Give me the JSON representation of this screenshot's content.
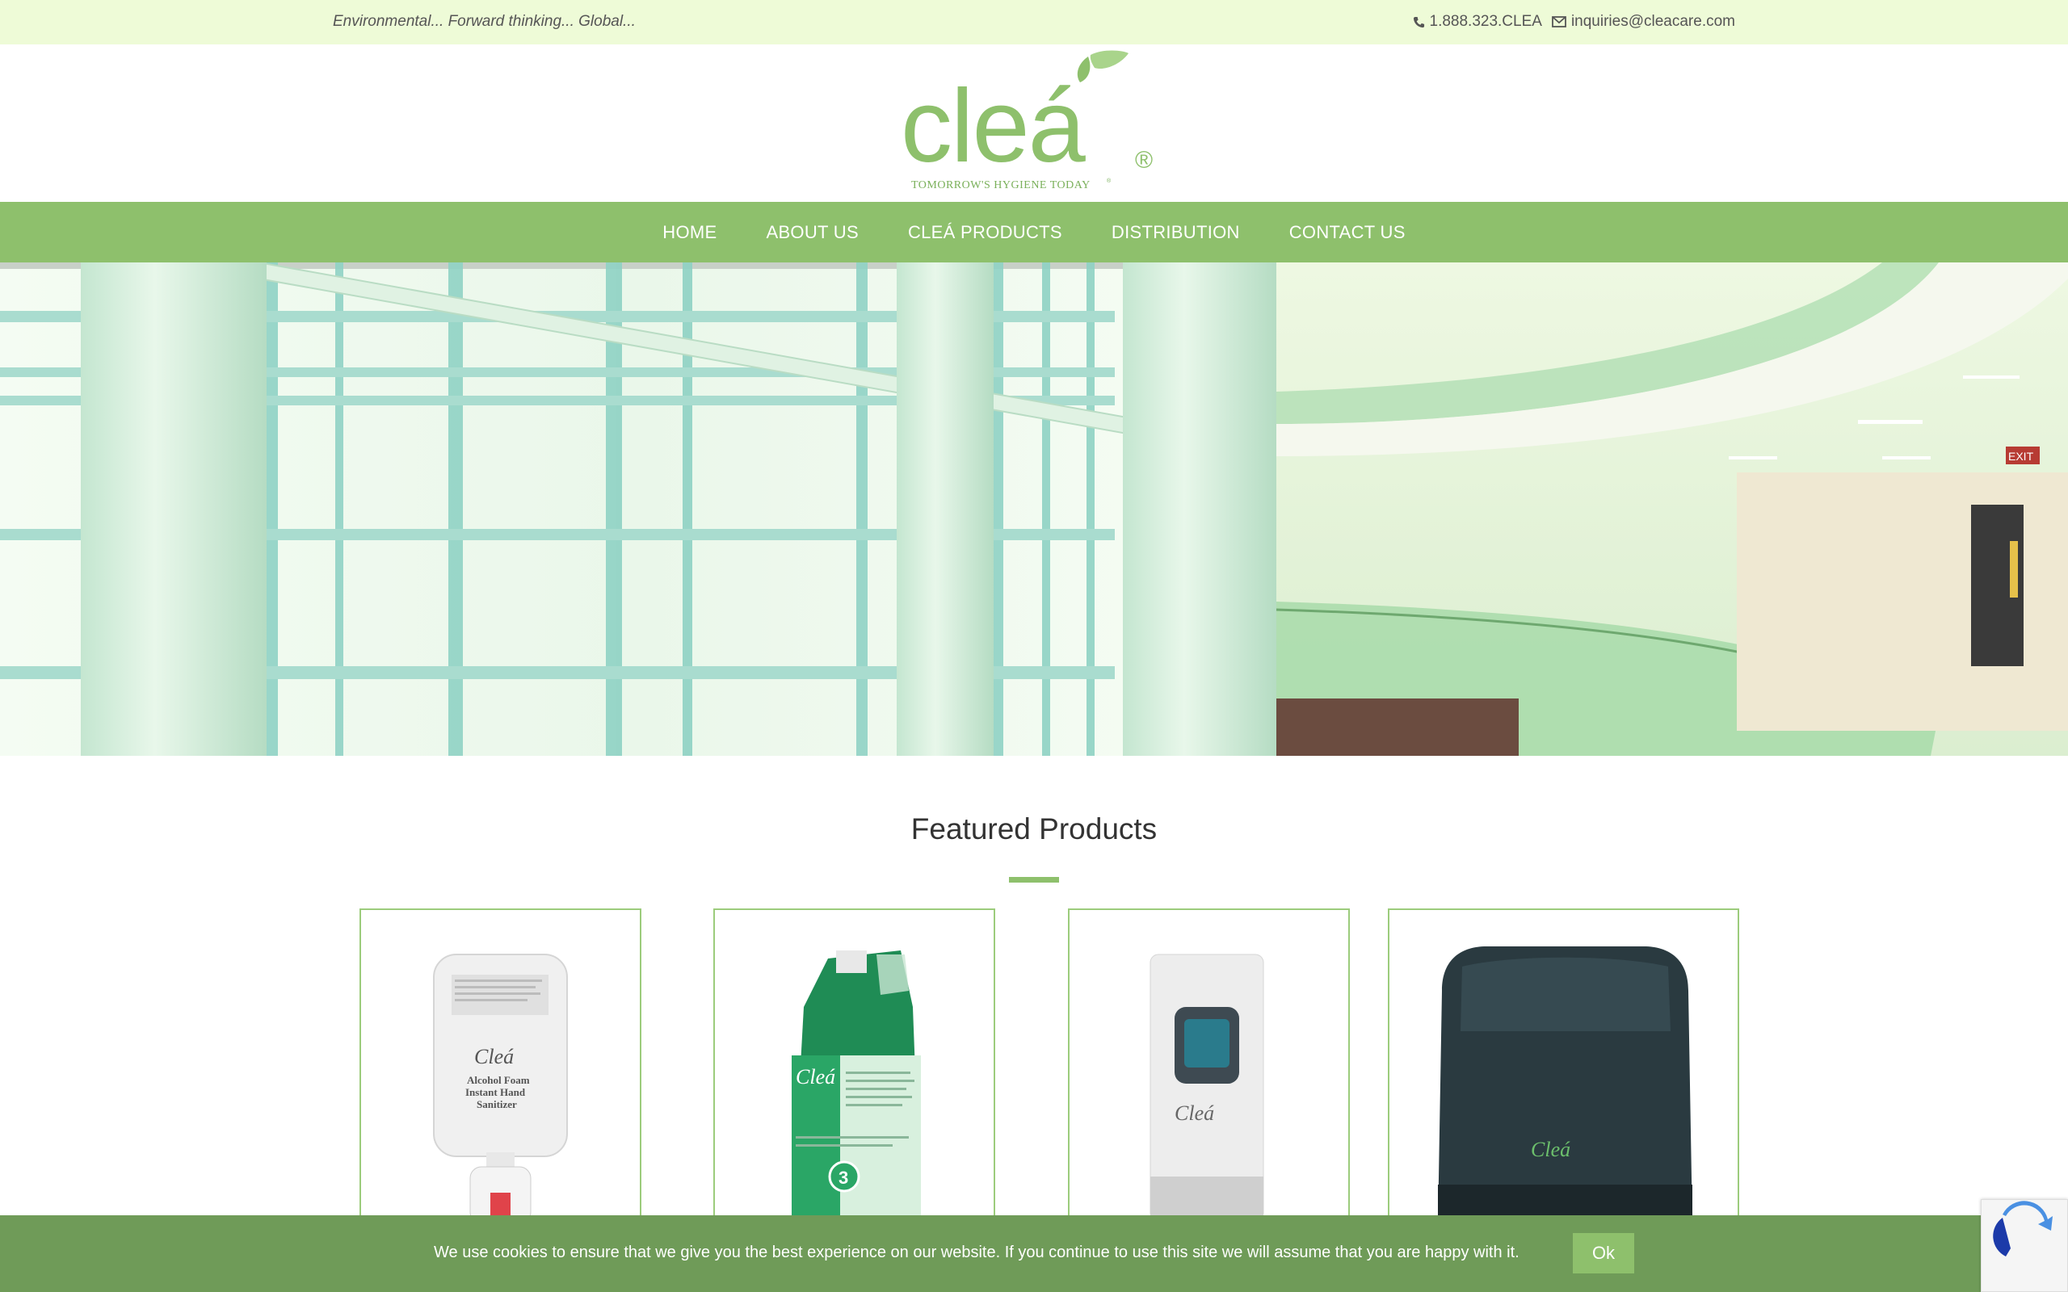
{
  "topbar": {
    "tagline": "Environmental... Forward thinking... Global...",
    "phone": "1.888.323.CLEA",
    "email": "inquiries@cleacare.com"
  },
  "logo": {
    "wordmark": "cleá",
    "registered": "®",
    "slogan": "TOMORROW'S HYGIENE TODAY",
    "slogan_mark": "®"
  },
  "nav": {
    "items": [
      "HOME",
      "ABOUT US",
      "CLEÁ PRODUCTS",
      "DISTRIBUTION",
      "CONTACT US"
    ]
  },
  "hero": {
    "exit_sign": "EXIT"
  },
  "featured": {
    "title": "Featured Products",
    "products": [
      {
        "brand": "Cleá",
        "line1": "Alcohol Foam",
        "line2": "Instant Hand",
        "line3": "Sanitizer"
      },
      {
        "brand": "Cleá",
        "badge": "3"
      },
      {
        "brand": "Cleá"
      },
      {
        "brand": "Cleá"
      }
    ]
  },
  "cookie": {
    "message": "We use cookies to ensure that we give you the best experience on our website. If you continue to use this site we will assume that you are happy with it.",
    "ok_label": "Ok"
  },
  "colors": {
    "brand_green": "#8ec06c",
    "topbar_bg": "#eefbd7",
    "cookie_bg": "#6f9b58"
  },
  "icons": [
    "phone-icon",
    "envelope-icon",
    "leaf-icon"
  ]
}
